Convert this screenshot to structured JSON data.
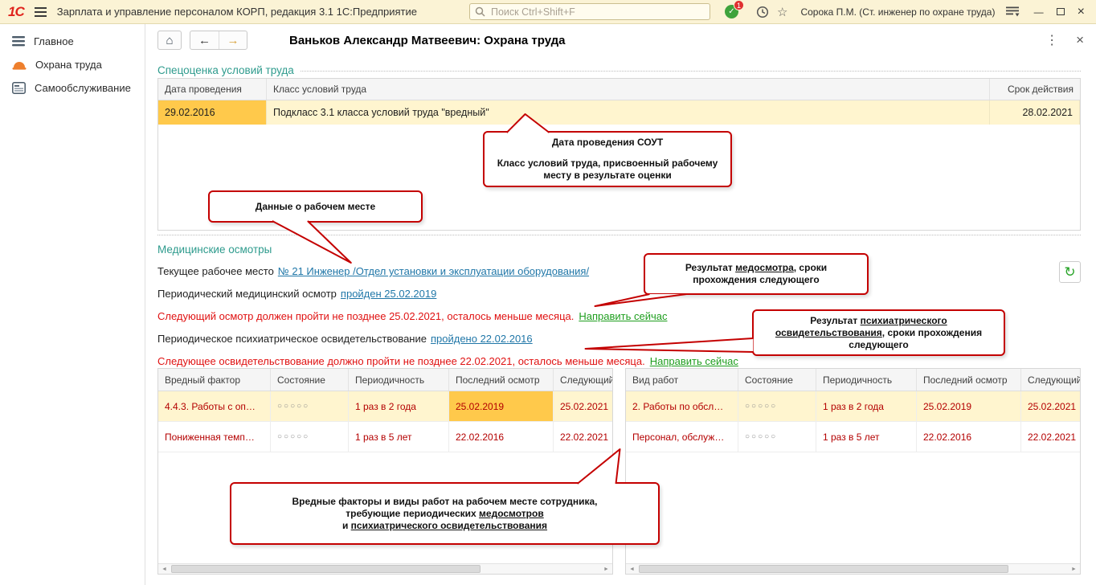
{
  "topbar": {
    "logo": "1С",
    "app_title": "Зарплата и управление персоналом КОРП, редакция 3.1 1С:Предприятие",
    "search_placeholder": "Поиск Ctrl+Shift+F",
    "notification_count": "1",
    "user_name": "Сорока П.М. (Ст. инженер по охране труда)"
  },
  "icons": {
    "star": "☆",
    "check": "✓",
    "dots": "⋮",
    "back": "←",
    "forward": "→",
    "home": "⌂",
    "close": "×",
    "minimize": "—",
    "refresh": "↻",
    "scroll_left": "◄",
    "scroll_right": "►"
  },
  "sidebar": {
    "items": [
      {
        "label": "Главное"
      },
      {
        "label": "Охрана труда"
      },
      {
        "label": "Самообслуживание"
      }
    ]
  },
  "page": {
    "title": "Ваньков Александр Матвеевич: Охрана труда"
  },
  "sout": {
    "section_title": "Спецоценка условий труда",
    "headers": [
      "Дата проведения",
      "Класс условий труда",
      "Срок действия"
    ],
    "row": {
      "date": "29.02.2016",
      "class_label": "Подкласс 3.1 класса условий труда \"вредный\"",
      "valid_until": "28.02.2021"
    }
  },
  "medical": {
    "section_title": "Медицинские осмотры",
    "workplace_label": "Текущее рабочее место",
    "workplace_link": "№ 21 Инженер /Отдел установки и эксплуатации оборудования/",
    "exam_label": "Периодический медицинский осмотр",
    "exam_link": "пройден 25.02.2019",
    "exam_warning": "Следующий осмотр должен пройти не позднее 25.02.2021, осталось меньше месяца.",
    "exam_action": "Направить сейчас",
    "psych_label": "Периодическое психиатрическое освидетельствование",
    "psych_link": "пройдено 22.02.2016",
    "psych_warning": "Следующее освидетельствование должно пройти не позднее 22.02.2021, осталось меньше месяца.",
    "psych_action": "Направить сейчас"
  },
  "factors_table": {
    "headers": [
      "Вредный фактор",
      "Состояние",
      "Периодичность",
      "Последний осмотр",
      "Следующий"
    ],
    "rows": [
      {
        "name": "4.4.3. Работы с оп…",
        "state": "○○○○○",
        "period": "1 раз в 2 года",
        "last": "25.02.2019",
        "next": "25.02.2021"
      },
      {
        "name": "Пониженная темп…",
        "state": "○○○○○",
        "period": "1 раз в 5 лет",
        "last": "22.02.2016",
        "next": "22.02.2021"
      }
    ]
  },
  "works_table": {
    "headers": [
      "Вид работ",
      "Состояние",
      "Периодичность",
      "Последний осмотр",
      "Следующий"
    ],
    "rows": [
      {
        "name": "2. Работы по обсл…",
        "state": "○○○○○",
        "period": "1 раз в 2 года",
        "last": "25.02.2019",
        "next": "25.02.2021"
      },
      {
        "name": "Персонал, обслуж…",
        "state": "○○○○○",
        "period": "1 раз в 5 лет",
        "last": "22.02.2016",
        "next": "22.02.2021"
      }
    ]
  },
  "callouts": {
    "sout_note": {
      "line1": "Дата проведения СОУТ",
      "line2": "Класс условий труда, присвоенный рабочему месту в результате оценки"
    },
    "workplace_note": {
      "text": "Данные о рабочем месте"
    },
    "exam_note": {
      "p1": "Результат ",
      "p2": "медосмотра",
      "p3": ", сроки прохождения следующего"
    },
    "psych_note": {
      "p1": "Результат ",
      "p2": "психиатрического освидетельствования",
      "p3": ", сроки прохождения следующего"
    },
    "tables_note": {
      "l1": "Вредные факторы и виды работ на рабочем месте сотрудника,",
      "l2a": "требующие периодических ",
      "l2b": "медосмотров",
      "l3a": "и ",
      "l3b": "психиатрического освидетельствования"
    }
  },
  "colors": {
    "accent_red": "#C40000",
    "warning_text": "#E01212",
    "link": "#2077A8",
    "green_link": "#1E9E1E",
    "section_title": "#2E9B8D",
    "highlight_cell": "#FFC94B",
    "highlight_row": "#FFF5CF",
    "topbar_bg": "#FBF3D5"
  }
}
